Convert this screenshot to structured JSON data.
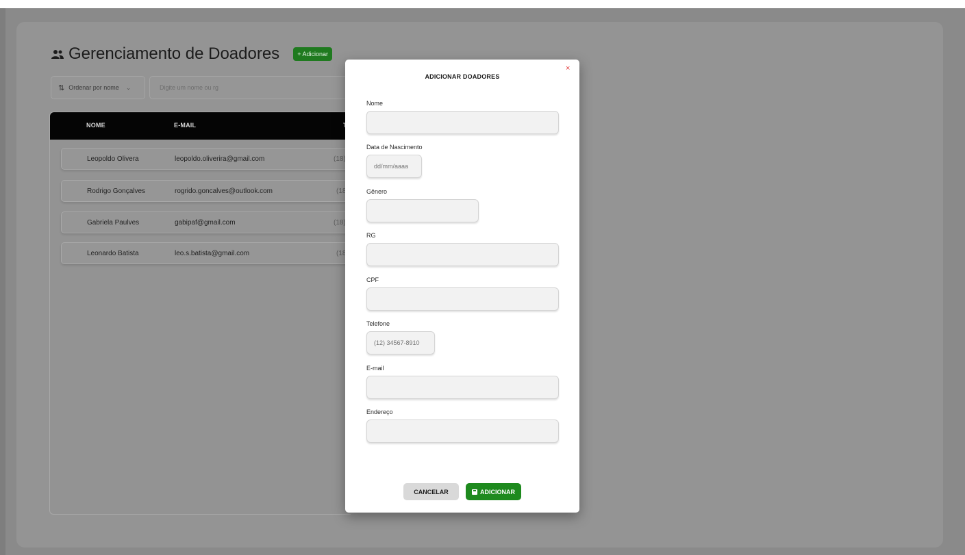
{
  "page": {
    "title": "Gerenciamento de Doadores",
    "add_button": "+ Adicionar"
  },
  "toolbar": {
    "sort_label": "Ordenar por nome",
    "search_placeholder": "Digite um nome ou rg"
  },
  "table": {
    "columns": [
      "NOME",
      "E-MAIL",
      "T"
    ],
    "rows": [
      {
        "nome": "Leopoldo Olivera",
        "email": "leopoldo.oliverira@gmail.com",
        "tel": "(18)"
      },
      {
        "nome": "Rodrigo Gonçalves",
        "email": "rogrido.goncalves@outlook.com",
        "tel": "(18"
      },
      {
        "nome": "Gabriela Paulves",
        "email": "gabipaf@gmail.com",
        "tel": "(18)"
      },
      {
        "nome": "Leonardo Batista",
        "email": "leo.s.batista@gmail.com",
        "tel": "(18"
      }
    ]
  },
  "modal": {
    "title": "ADICIONAR DOADORES",
    "close": "×",
    "fields": {
      "nome": {
        "label": "Nome",
        "placeholder": ""
      },
      "nascimento": {
        "label": "Data de Nascimento",
        "placeholder": "dd/mm/aaaa"
      },
      "genero": {
        "label": "Gênero",
        "placeholder": ""
      },
      "rg": {
        "label": "RG",
        "placeholder": ""
      },
      "cpf": {
        "label": "CPF",
        "placeholder": ""
      },
      "telefone": {
        "label": "Telefone",
        "placeholder": "(12) 34567-8910"
      },
      "email": {
        "label": "E-mail",
        "placeholder": ""
      },
      "endereco": {
        "label": "Endereço",
        "placeholder": ""
      }
    },
    "cancel_label": "CANCELAR",
    "submit_label": "ADICIONAR"
  },
  "colors": {
    "accent_green": "#1e8a1e",
    "close_red": "#e23b3b",
    "table_header": "#050505"
  },
  "icons": {
    "title": "users-icon",
    "sort": "sort-icon",
    "chevron": "chevron-down-icon",
    "close": "close-icon",
    "save": "save-icon"
  }
}
